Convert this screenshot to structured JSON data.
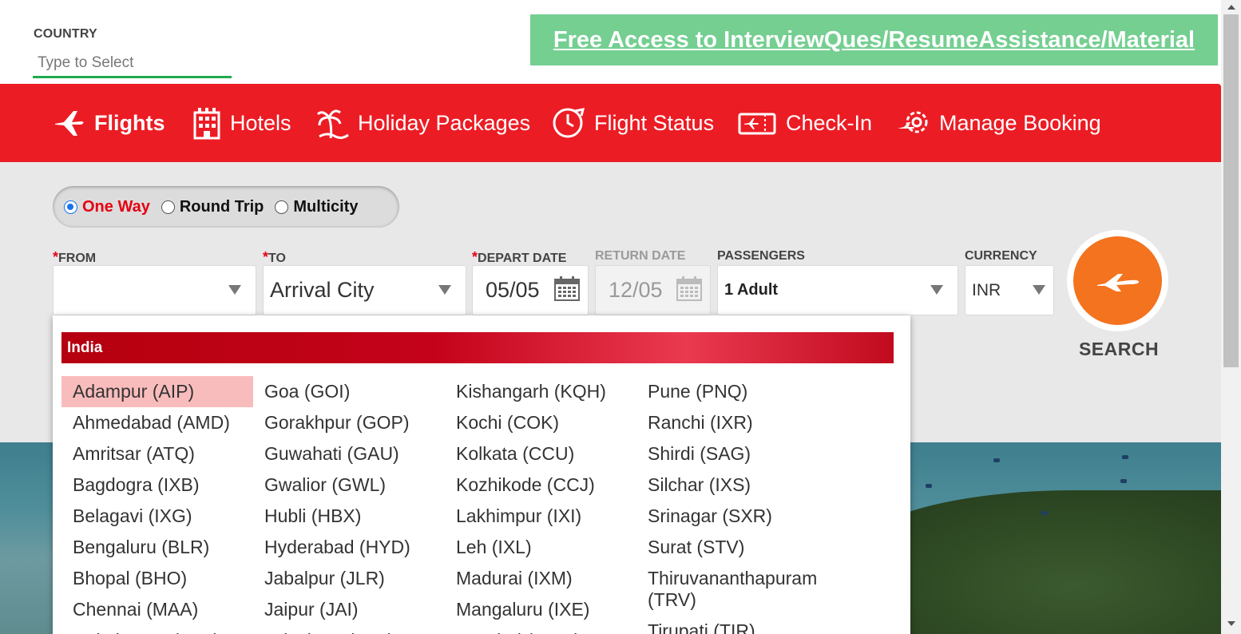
{
  "country": {
    "label": "COUNTRY",
    "placeholder": "Type to Select"
  },
  "promo": {
    "text": "Free Access to InterviewQues/ResumeAssistance/Material"
  },
  "nav": {
    "items": [
      {
        "label": "Flights",
        "icon": "plane-icon",
        "active": true
      },
      {
        "label": "Hotels",
        "icon": "hotel-icon"
      },
      {
        "label": "Holiday Packages",
        "icon": "palm-tree-icon"
      },
      {
        "label": "Flight Status",
        "icon": "clock-plane-icon"
      },
      {
        "label": "Check-In",
        "icon": "ticket-icon"
      },
      {
        "label": "Manage Booking",
        "icon": "gear-plane-icon"
      }
    ],
    "color": "#ec1c24"
  },
  "trip": {
    "options": [
      {
        "label": "One Way",
        "selected": true
      },
      {
        "label": "Round Trip"
      },
      {
        "label": "Multicity"
      }
    ]
  },
  "form": {
    "required_mark": "*",
    "from": {
      "label": "FROM",
      "value": ""
    },
    "to": {
      "label": "TO",
      "value": "Arrival City"
    },
    "depart": {
      "label": "DEPART DATE",
      "value": "05/05"
    },
    "return": {
      "label": "RETURN DATE",
      "value": "12/05"
    },
    "passengers": {
      "label": "PASSENGERS",
      "value": "1 Adult"
    },
    "currency": {
      "label": "CURRENCY",
      "value": "INR"
    },
    "search_label": "SEARCH",
    "accent": "#f4731f"
  },
  "dropdown": {
    "region": "India",
    "columns": [
      [
        "Adampur (AIP)",
        "Ahmedabad (AMD)",
        "Amritsar (ATQ)",
        "Bagdogra (IXB)",
        "Belagavi (IXG)",
        "Bengaluru (BLR)",
        "Bhopal (BHO)",
        "Chennai (MAA)",
        "Coimbatore (CJB)"
      ],
      [
        "Goa (GOI)",
        "Gorakhpur (GOP)",
        "Guwahati (GAU)",
        "Gwalior (GWL)",
        "Hubli (HBX)",
        "Hyderabad (HYD)",
        "Jabalpur (JLR)",
        "Jaipur (JAI)",
        "Jaisalmer (JSA)"
      ],
      [
        "Kishangarh (KQH)",
        "Kochi (COK)",
        "Kolkata (CCU)",
        "Kozhikode (CCJ)",
        "Lakhimpur (IXI)",
        "Leh (IXL)",
        "Madurai (IXM)",
        "Mangaluru (IXE)",
        "Mumbai (BOM)"
      ],
      [
        "Pune (PNQ)",
        "Ranchi (IXR)",
        "Shirdi (SAG)",
        "Silchar (IXS)",
        "Srinagar (SXR)",
        "Surat (STV)",
        "Thiruvananthapuram (TRV)",
        "Tirupati (TIR)"
      ]
    ],
    "highlighted": "Adampur (AIP)"
  }
}
